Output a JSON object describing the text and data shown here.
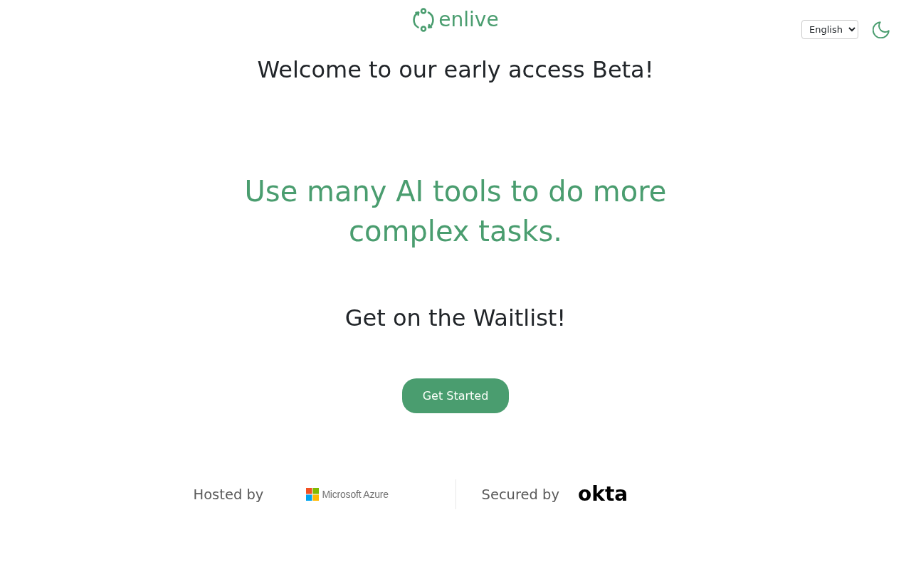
{
  "header": {
    "logo_text": "enlive",
    "language_select": {
      "value": "English"
    }
  },
  "hero": {
    "welcome": "Welcome to our early access Beta!",
    "tagline": "Use many AI tools to do more complex tasks.",
    "waitlist_heading": "Get on the Waitlist!",
    "cta_button": "Get Started"
  },
  "footer": {
    "partners": [
      {
        "kind": "azure",
        "label": "Hosted by",
        "logo_text": "Microsoft Azure"
      },
      {
        "kind": "okta",
        "label": "Secured by",
        "logo_text": "okta"
      }
    ]
  }
}
